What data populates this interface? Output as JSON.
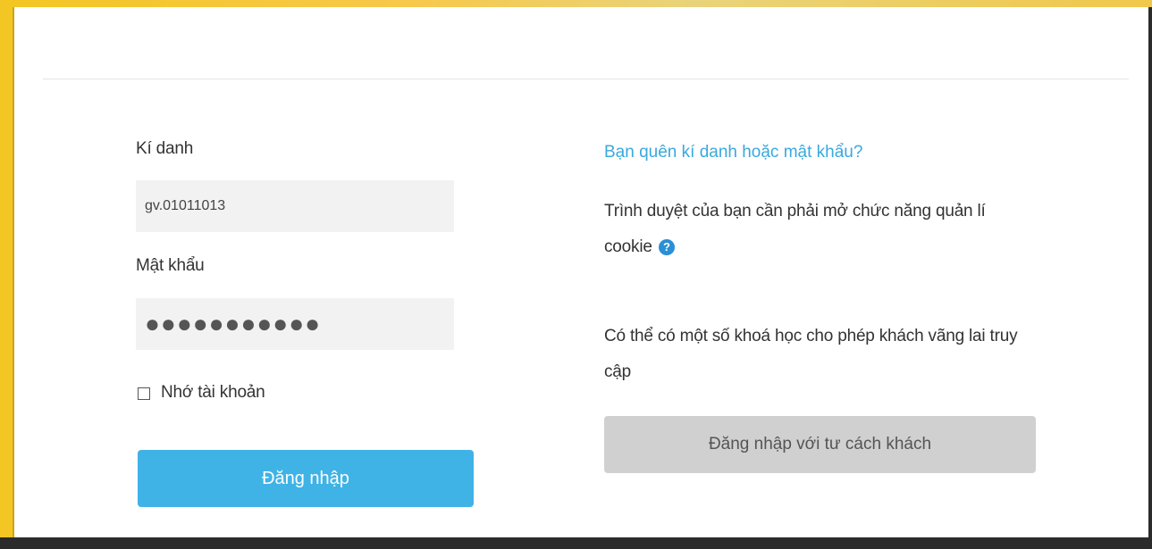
{
  "login": {
    "username_label": "Kí danh",
    "username_value": "gv.01011013",
    "password_label": "Mật khẩu",
    "password_mask": "●●●●●●●●●●●",
    "remember_label": "Nhớ tài khoản",
    "submit_label": "Đăng nhập"
  },
  "info": {
    "forgot_link": "Bạn quên kí danh hoặc mật khẩu?",
    "cookie_text_line1": "Trình duyệt của bạn cần phải mở chức năng quản lí",
    "cookie_text_line2": "cookie",
    "help_icon": "question-circle",
    "guest_text_line1": "Có thể có một số khoá học cho phép khách vãng lai truy",
    "guest_text_line2": "cập",
    "guest_button_label": "Đăng nhập với tư cách khách"
  },
  "colors": {
    "accent": "#3fb3e6",
    "link": "#39a9dd",
    "guest_button": "#d0d0d0",
    "frame": "#f3c623"
  }
}
